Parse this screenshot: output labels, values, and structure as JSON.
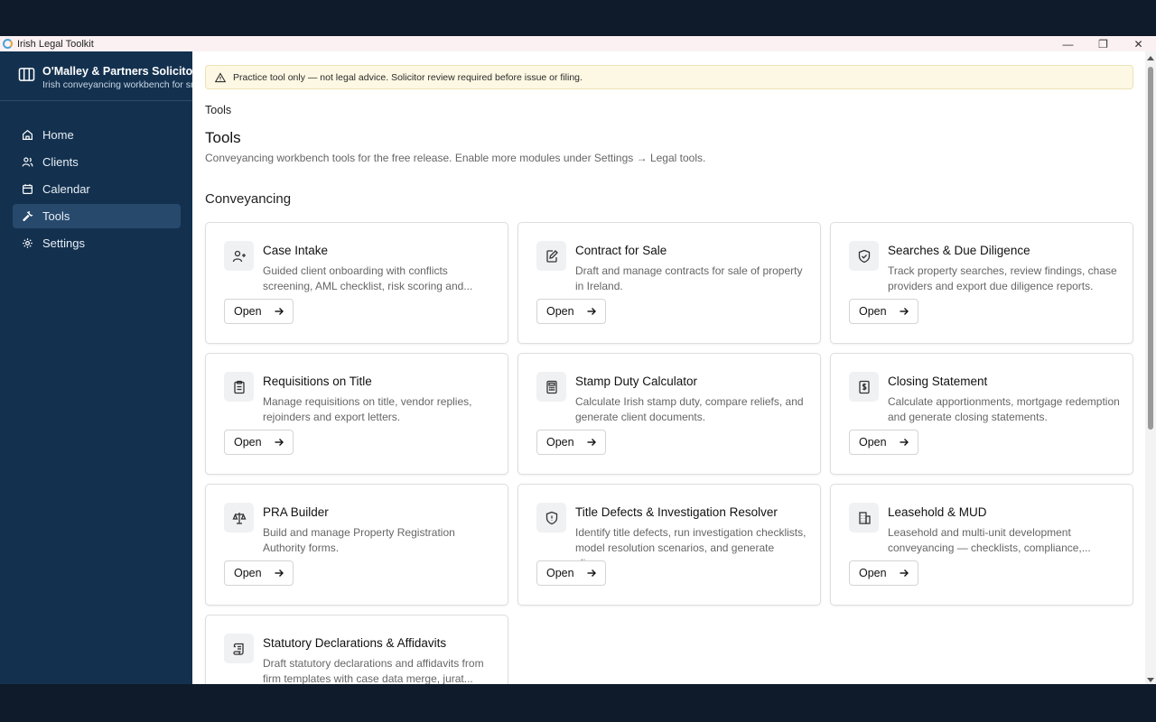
{
  "window": {
    "title": "Irish Legal Toolkit",
    "controls": {
      "minimize": "—",
      "maximize": "❐",
      "close": "✕"
    }
  },
  "sidebar": {
    "brand_name": "O'Malley & Partners Solicitors",
    "brand_subtitle": "Irish conveyancing workbench for small firms",
    "items": [
      {
        "label": "Home",
        "icon": "home-icon"
      },
      {
        "label": "Clients",
        "icon": "users-icon"
      },
      {
        "label": "Calendar",
        "icon": "calendar-icon"
      },
      {
        "label": "Tools",
        "icon": "wrench-icon",
        "active": true
      },
      {
        "label": "Settings",
        "icon": "gear-icon"
      }
    ]
  },
  "notice": "Practice tool only — not legal advice. Solicitor review required before issue or filing.",
  "breadcrumb": "Tools",
  "page": {
    "title": "Tools",
    "subtitle": "Conveyancing workbench tools for the free release. Enable more modules under Settings → Legal tools."
  },
  "section": {
    "title": "Conveyancing"
  },
  "open_label": "Open",
  "tools": [
    {
      "title": "Case Intake",
      "desc": "Guided client onboarding with conflicts screening, AML checklist, risk scoring and...",
      "icon": "user-plus-icon"
    },
    {
      "title": "Contract for Sale",
      "desc": "Draft and manage contracts for sale of property in Ireland.",
      "icon": "document-edit-icon"
    },
    {
      "title": "Searches & Due Diligence",
      "desc": "Track property searches, review findings, chase providers and export due diligence reports.",
      "icon": "shield-check-icon"
    },
    {
      "title": "Requisitions on Title",
      "desc": "Manage requisitions on title, vendor replies, rejoinders and export letters.",
      "icon": "clipboard-icon"
    },
    {
      "title": "Stamp Duty Calculator",
      "desc": "Calculate Irish stamp duty, compare reliefs, and generate client documents.",
      "icon": "calculator-icon"
    },
    {
      "title": "Closing Statement",
      "desc": "Calculate apportionments, mortgage redemption and generate closing statements.",
      "icon": "receipt-icon"
    },
    {
      "title": "PRA Builder",
      "desc": "Build and manage Property Registration Authority forms.",
      "icon": "scale-icon"
    },
    {
      "title": "Title Defects & Investigation Resolver",
      "desc": "Identify title defects, run investigation checklists, model resolution scenarios, and generate clien...",
      "icon": "shield-alert-icon"
    },
    {
      "title": "Leasehold & MUD",
      "desc": "Leasehold and multi-unit development conveyancing — checklists, compliance,...",
      "icon": "building-icon"
    },
    {
      "title": "Statutory Declarations & Affidavits",
      "desc": "Draft statutory declarations and affidavits from firm templates with case data merge, jurat...",
      "icon": "scroll-icon"
    }
  ]
}
